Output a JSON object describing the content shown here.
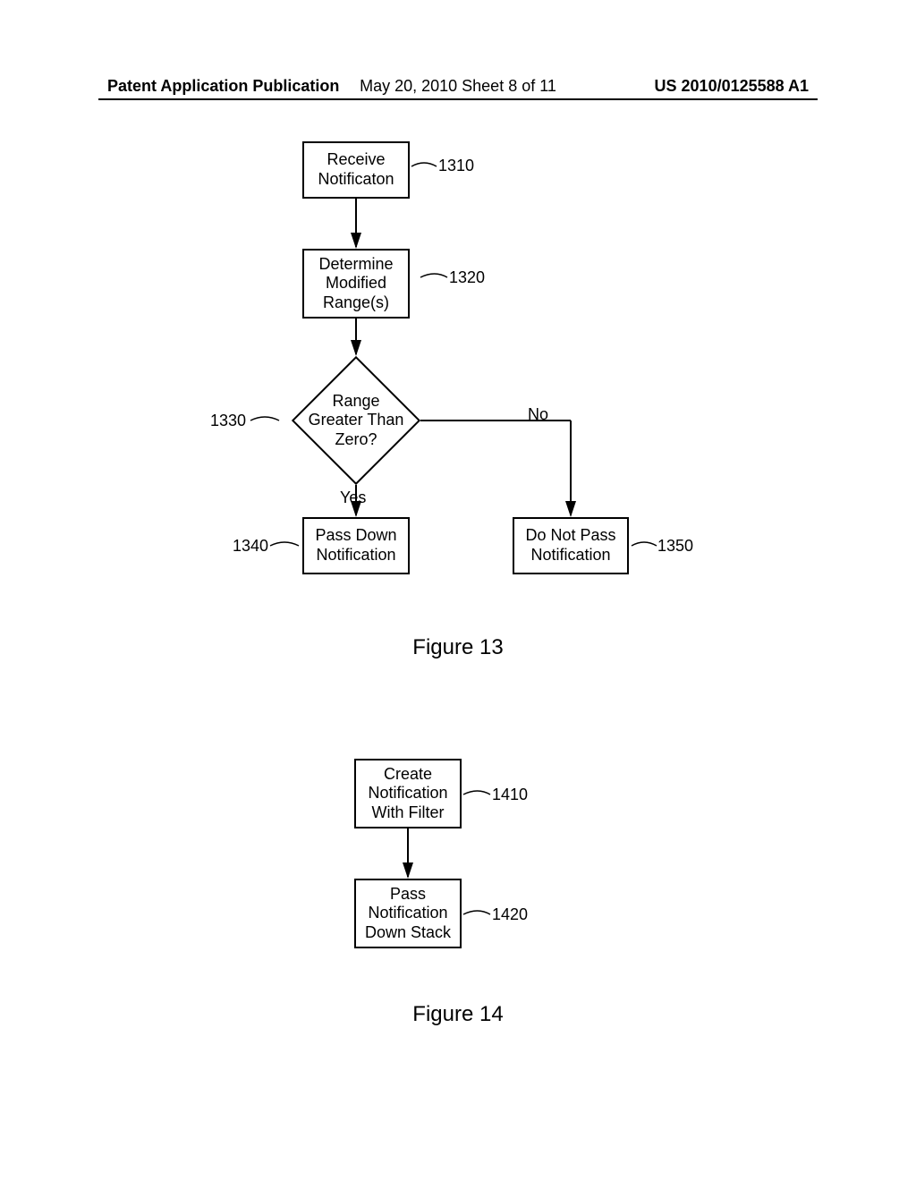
{
  "header": {
    "left": "Patent Application Publication",
    "center": "May 20, 2010  Sheet 8 of 11",
    "right": "US 2010/0125588 A1"
  },
  "fig13": {
    "box1310": "Receive\nNotificaton",
    "label1310": "1310",
    "box1320": "Determine\nModified\nRange(s)",
    "label1320": "1320",
    "diamond1330": "Range\nGreater Than\nZero?",
    "label1330": "1330",
    "yes": "Yes",
    "no": "No",
    "box1340": "Pass Down\nNotification",
    "label1340": "1340",
    "box1350": "Do Not Pass\nNotification",
    "label1350": "1350",
    "title": "Figure 13"
  },
  "fig14": {
    "box1410": "Create\nNotification\nWith Filter",
    "label1410": "1410",
    "box1420": "Pass\nNotification\nDown Stack",
    "label1420": "1420",
    "title": "Figure 14"
  }
}
